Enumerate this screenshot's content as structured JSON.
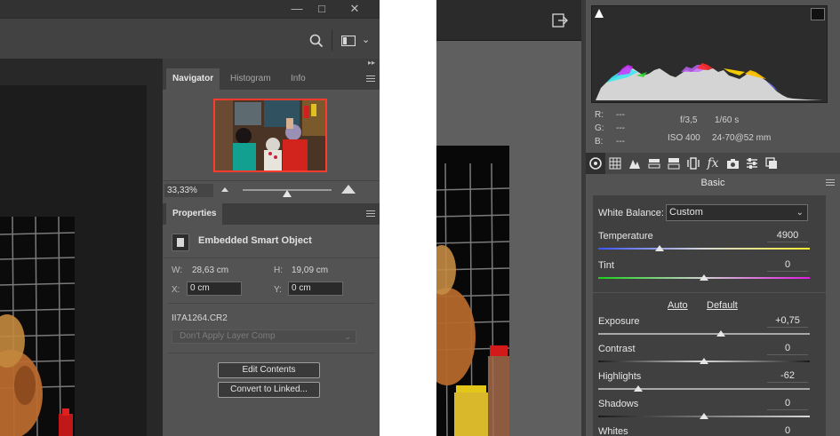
{
  "photoshop": {
    "window_controls": {
      "minimize": "—",
      "maximize": "□",
      "close": "✕"
    },
    "toolbar": {
      "search_icon": "search-icon",
      "workspace_icon": "workspace-icon",
      "workspace_chevron": "⌄"
    },
    "collapse_glyph": "▸▸",
    "navigator_tabs": [
      "Navigator",
      "Histogram",
      "Info"
    ],
    "navigator": {
      "zoom_value": "33,33%",
      "zoom_fraction": 0.5
    },
    "properties": {
      "tab": "Properties",
      "object_type": "Embedded Smart Object",
      "w_label": "W:",
      "w_value": "28,63 cm",
      "h_label": "H:",
      "h_value": "19,09 cm",
      "x_label": "X:",
      "x_value": "0 cm",
      "y_label": "Y:",
      "y_value": "0 cm",
      "filename": "II7A1264.CR2",
      "layer_comp": "Don't Apply Layer Comp",
      "edit_button": "Edit Contents",
      "convert_button": "Convert to Linked..."
    }
  },
  "camera_raw": {
    "open_image_icon": "open-image-icon",
    "readout": {
      "r_label": "R:",
      "r_value": "---",
      "g_label": "G:",
      "g_value": "---",
      "b_label": "B:",
      "b_value": "---",
      "aperture": "f/3,5",
      "shutter": "1/60 s",
      "iso": "ISO 400",
      "lens": "24-70@52 mm"
    },
    "panel_title": "Basic",
    "white_balance": {
      "label": "White Balance:",
      "value": "Custom"
    },
    "sliders": [
      {
        "label": "Temperature",
        "value": "4900",
        "fraction": 0.29
      },
      {
        "label": "Tint",
        "value": "0",
        "fraction": 0.5
      },
      {
        "label": "Exposure",
        "value": "+0,75",
        "fraction": 0.58
      },
      {
        "label": "Contrast",
        "value": "0",
        "fraction": 0.5
      },
      {
        "label": "Highlights",
        "value": "-62",
        "fraction": 0.19
      },
      {
        "label": "Shadows",
        "value": "0",
        "fraction": 0.5
      },
      {
        "label": "Whites",
        "value": "0",
        "fraction": 0.5
      }
    ],
    "auto_link": "Auto",
    "default_link": "Default",
    "colors": {
      "accent": "#ff3b30"
    }
  }
}
